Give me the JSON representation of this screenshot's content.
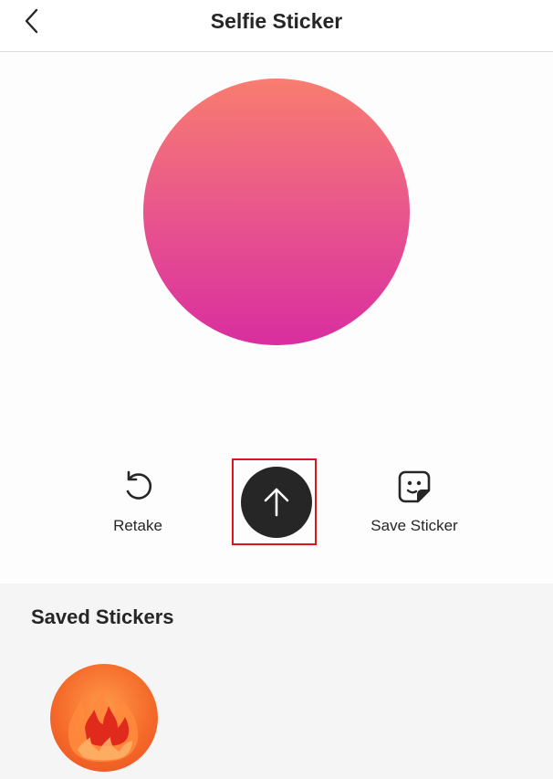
{
  "header": {
    "title": "Selfie Sticker",
    "back_icon": "chevron-left-icon"
  },
  "preview": {
    "gradient_top": "#f87d6f",
    "gradient_bottom": "#d92e9f"
  },
  "actions": {
    "retake_label": "Retake",
    "retake_icon": "rotate-ccw-icon",
    "upload_icon": "arrow-up-icon",
    "save_label": "Save Sticker",
    "save_icon": "sticker-icon"
  },
  "highlight_color": "#e0141e",
  "saved": {
    "title": "Saved Stickers",
    "items": [
      {
        "icon": "fire-sticker-icon",
        "color": "#f56b2a"
      }
    ]
  }
}
